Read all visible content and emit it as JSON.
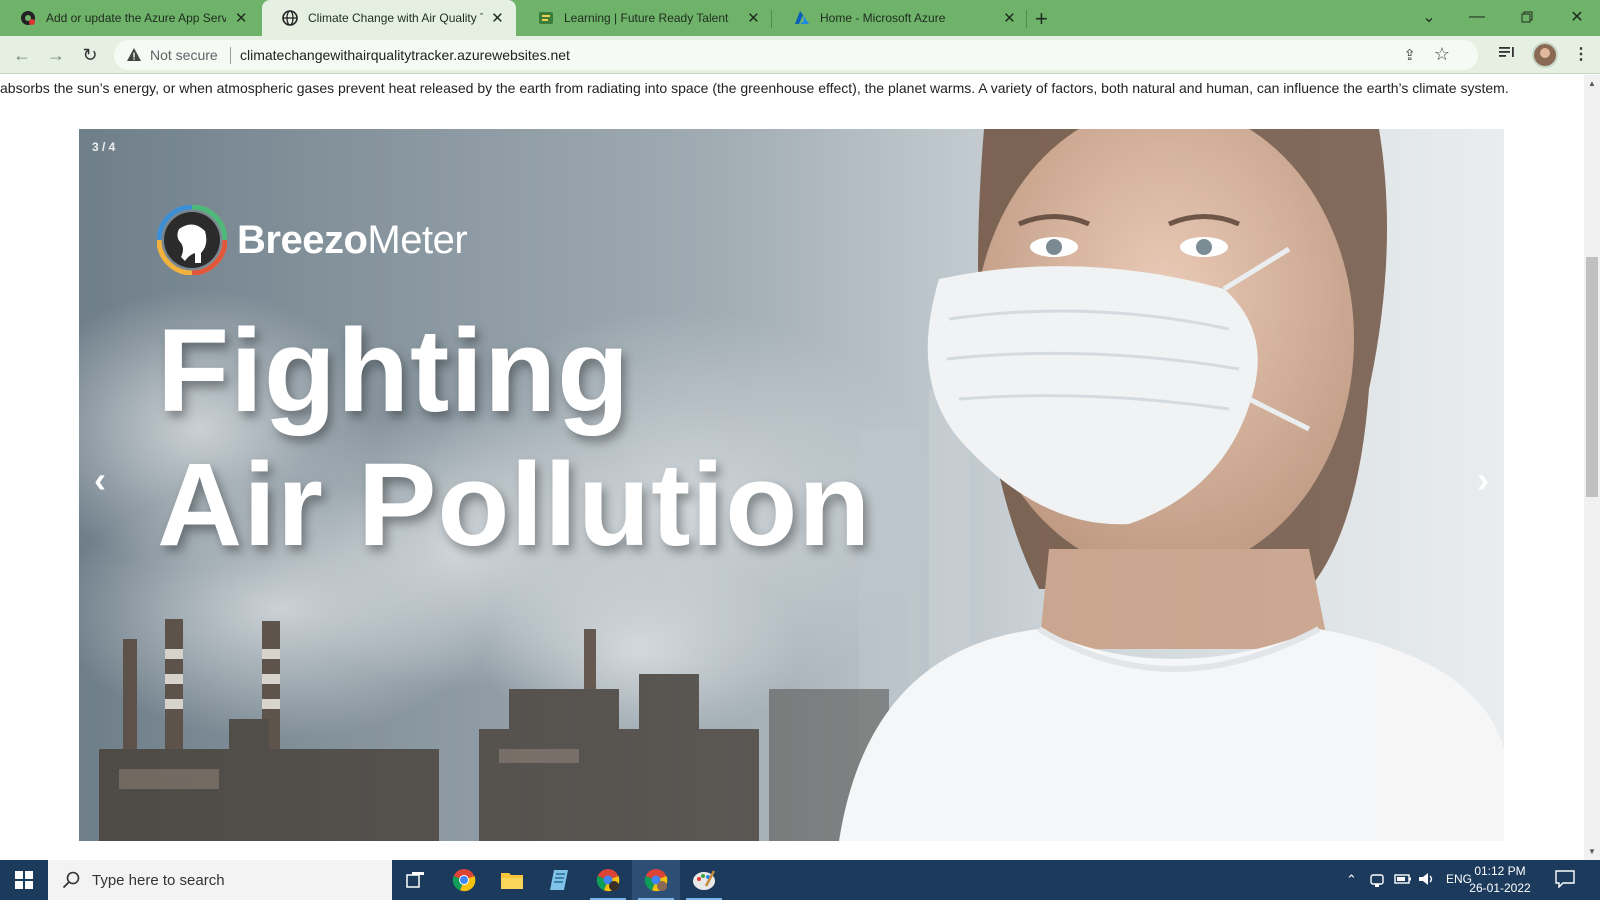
{
  "browser": {
    "tabs": [
      {
        "title": "Add or update the Azure App Servic",
        "favicon": "github-icon",
        "active": false
      },
      {
        "title": "Climate Change with Air Quality Tra",
        "favicon": "globe-icon",
        "active": true
      },
      {
        "title": "Learning | Future Ready Talent",
        "favicon": "learning-icon",
        "active": false
      },
      {
        "title": "Home - Microsoft Azure",
        "favicon": "azure-icon",
        "active": false
      }
    ],
    "new_tab_label": "+",
    "security_label": "Not secure",
    "url": "climatechangewithairqualitytracker.azurewebsites.net"
  },
  "page": {
    "intro_text": "absorbs the sun’s energy, or when atmospheric gases prevent heat released by the earth from radiating into space (the greenhouse effect), the planet warms. A variety of factors, both natural and human, can influence the earth’s climate system.",
    "slideshow": {
      "counter": "3 / 4",
      "logo_bold": "Breezo",
      "logo_regular": "Meter",
      "headline_line1": "Fighting",
      "headline_line2": "Air Pollution",
      "prev_label": "‹",
      "next_label": "›"
    }
  },
  "taskbar": {
    "search_placeholder": "Type here to search",
    "language": "ENG",
    "time": "01:12 PM",
    "date": "26-01-2022"
  },
  "colors": {
    "tabstrip": "#6fb26a",
    "toolbar": "#e5f0e3",
    "taskbar": "#1b3a5c"
  }
}
